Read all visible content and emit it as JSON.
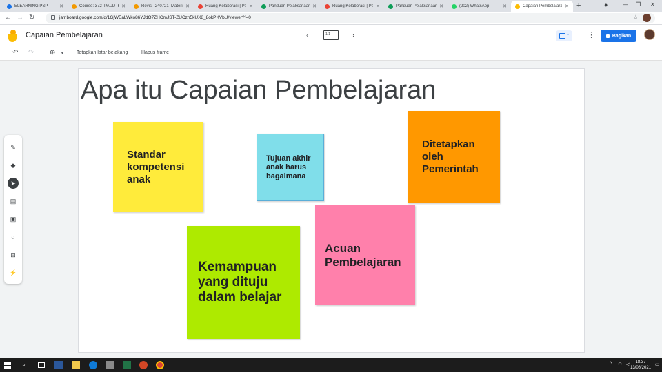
{
  "browser": {
    "tabs": [
      {
        "label": "ELEARNING PSP",
        "color": "#1a73e8"
      },
      {
        "label": "Course: 372_PAUD_KI",
        "color": "#f29900"
      },
      {
        "label": "Revisi_240721_Materi",
        "color": "#f29900"
      },
      {
        "label": "Ruang Kolaborasi | Pe",
        "color": "#ea4335"
      },
      {
        "label": "Panduan Pelaksanaan",
        "color": "#0f9d58"
      },
      {
        "label": "Ruang Kolaborasi | Pe",
        "color": "#ea4335"
      },
      {
        "label": "Panduan Pelaksanaan",
        "color": "#0f9d58"
      },
      {
        "label": "(202) WhatsApp",
        "color": "#25d366"
      },
      {
        "label": "Capaian Pembelajaran",
        "color": "#fbbc04"
      }
    ],
    "url": "jamboard.google.com/d/1GjWEaLWko86YJdO7ZHCmJST-ZUCzn5kUX8_8okPKVbU/viewer?f=0"
  },
  "app": {
    "title": "Capaian Pembelajaran",
    "frame_counter": "1/1",
    "share_label": "Bagikan"
  },
  "toolbar": {
    "set_background": "Tetapkan latar belakang",
    "clear_frame": "Hapus frame"
  },
  "canvas": {
    "heading": "Apa itu Capaian Pembelajaran",
    "notes": [
      {
        "text": [
          "Standar",
          "kompetensi",
          "anak"
        ],
        "color": "#ffeb3b"
      },
      {
        "text": [
          "Tujuan akhir",
          "anak harus",
          "bagaimana"
        ],
        "color": "#80deea"
      },
      {
        "text": [
          "Ditetapkan",
          "oleh",
          "Pemerintah"
        ],
        "color": "#ff9800"
      },
      {
        "text": [
          "Acuan",
          "Pembelajaran"
        ],
        "color": "#ff80ab"
      },
      {
        "text": [
          "Kemampuan",
          "yang dituju",
          "dalam belajar"
        ],
        "color": "#aeea00"
      }
    ]
  },
  "taskbar": {
    "time": "18.37",
    "date": "13/08/2021"
  }
}
